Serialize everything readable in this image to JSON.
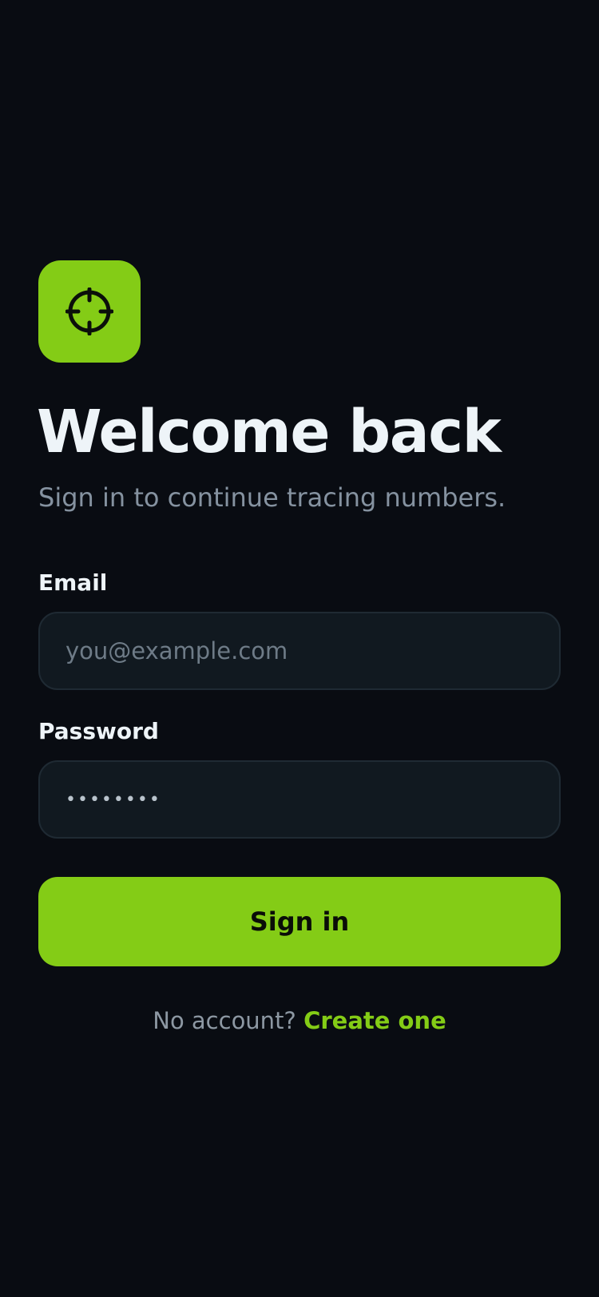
{
  "app": {
    "logo_icon": "crosshair-icon",
    "accent_color": "#84cc16",
    "background_color": "#090c12"
  },
  "header": {
    "title": "Welcome back",
    "subtitle": "Sign in to continue tracing numbers."
  },
  "form": {
    "email": {
      "label": "Email",
      "value": "",
      "placeholder": "you@example.com"
    },
    "password": {
      "label": "Password",
      "value": "••••••••"
    },
    "submit_label": "Sign in"
  },
  "footer": {
    "prompt": "No account? ",
    "link_label": "Create one"
  }
}
